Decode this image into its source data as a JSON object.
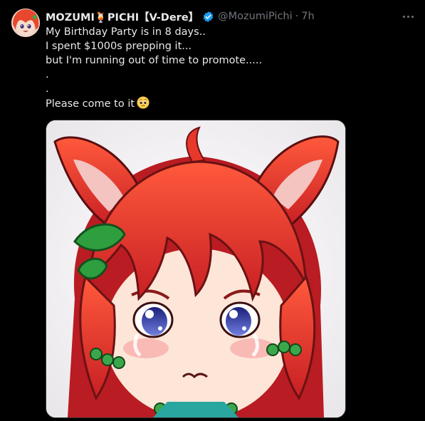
{
  "tweet": {
    "display_name": "MOZUMI🍹PICHI【V-Dere】",
    "handle": "@MozumiPichi",
    "separator": "·",
    "time": "7h",
    "lines": [
      "My Birthday Party is in 8 days..",
      "I spent $1000s prepping it...",
      "but I'm running out of time to promote.....",
      ".",
      ".",
      "Please come to it"
    ],
    "trailing_emoji": "pleading-face-emoji",
    "media_alt": "anime illustration"
  },
  "icons": {
    "verified": "verified-badge-icon",
    "more": "more-options-icon"
  },
  "colors": {
    "background": "#000000",
    "text": "#e7e9ea",
    "muted": "#71767b",
    "verified_blue": "#1d9bf0",
    "hair_red": "#e8372b",
    "leaf_green": "#2e9e3f"
  }
}
